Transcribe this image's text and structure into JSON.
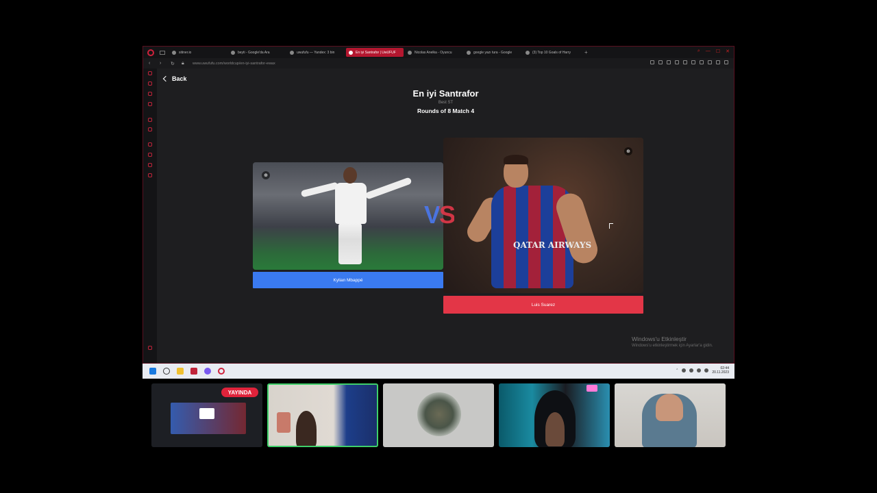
{
  "browser": {
    "tabs": [
      {
        "label": "sitiner.io",
        "active": false
      },
      {
        "label": "beyti - Google'da Ara",
        "active": false
      },
      {
        "label": "uwufufu — Yandex: 3 bin",
        "active": false
      },
      {
        "label": "En iyi Santrafor | UwUFUF",
        "active": true
      },
      {
        "label": "Nicolas Anelka - Oyuncu",
        "active": false
      },
      {
        "label": "google yazı tura - Google",
        "active": false
      },
      {
        "label": "(3) Top 10 Goals of Harry",
        "active": false
      }
    ],
    "new_tab": "+",
    "url": "www.uwufufu.com/worldcup/en-iyi-santrafor-ewax"
  },
  "page": {
    "back_label": "Back",
    "title": "En iyi Santrafor",
    "subtitle": "Best ST",
    "round": "Rounds of 8 Match 4",
    "vs_label": "VS",
    "left_choice": {
      "name": "Kylian Mbappé",
      "color": "#3a7af0"
    },
    "right_choice": {
      "name": "Luis Suarez",
      "color": "#e33647",
      "sponsor": "QATAR AIRWAYS"
    }
  },
  "watermark": {
    "title": "Windows'u Etkinleştir",
    "sub": "Windows'u etkinleştirmek için Ayarlar'a gidin."
  },
  "taskbar": {
    "time": "02:44",
    "date": "20.11.2023"
  },
  "stream": {
    "live_badge": "YAYINDA"
  },
  "colors": {
    "accent": "#d0223c",
    "left_button": "#3a7af0",
    "right_button": "#e33647"
  }
}
